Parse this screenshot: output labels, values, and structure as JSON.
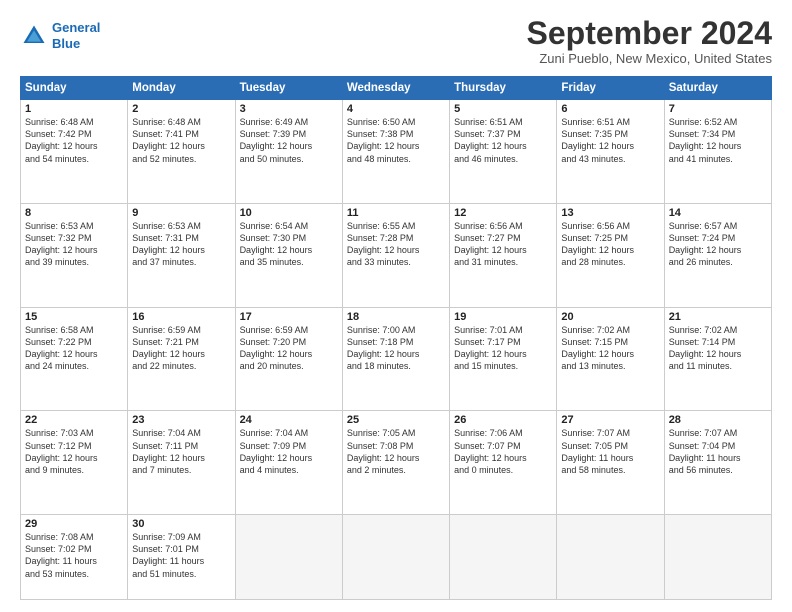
{
  "logo": {
    "line1": "General",
    "line2": "Blue"
  },
  "title": "September 2024",
  "subtitle": "Zuni Pueblo, New Mexico, United States",
  "header_days": [
    "Sunday",
    "Monday",
    "Tuesday",
    "Wednesday",
    "Thursday",
    "Friday",
    "Saturday"
  ],
  "weeks": [
    [
      {
        "num": "1",
        "info": "Sunrise: 6:48 AM\nSunset: 7:42 PM\nDaylight: 12 hours\nand 54 minutes."
      },
      {
        "num": "2",
        "info": "Sunrise: 6:48 AM\nSunset: 7:41 PM\nDaylight: 12 hours\nand 52 minutes."
      },
      {
        "num": "3",
        "info": "Sunrise: 6:49 AM\nSunset: 7:39 PM\nDaylight: 12 hours\nand 50 minutes."
      },
      {
        "num": "4",
        "info": "Sunrise: 6:50 AM\nSunset: 7:38 PM\nDaylight: 12 hours\nand 48 minutes."
      },
      {
        "num": "5",
        "info": "Sunrise: 6:51 AM\nSunset: 7:37 PM\nDaylight: 12 hours\nand 46 minutes."
      },
      {
        "num": "6",
        "info": "Sunrise: 6:51 AM\nSunset: 7:35 PM\nDaylight: 12 hours\nand 43 minutes."
      },
      {
        "num": "7",
        "info": "Sunrise: 6:52 AM\nSunset: 7:34 PM\nDaylight: 12 hours\nand 41 minutes."
      }
    ],
    [
      {
        "num": "8",
        "info": "Sunrise: 6:53 AM\nSunset: 7:32 PM\nDaylight: 12 hours\nand 39 minutes."
      },
      {
        "num": "9",
        "info": "Sunrise: 6:53 AM\nSunset: 7:31 PM\nDaylight: 12 hours\nand 37 minutes."
      },
      {
        "num": "10",
        "info": "Sunrise: 6:54 AM\nSunset: 7:30 PM\nDaylight: 12 hours\nand 35 minutes."
      },
      {
        "num": "11",
        "info": "Sunrise: 6:55 AM\nSunset: 7:28 PM\nDaylight: 12 hours\nand 33 minutes."
      },
      {
        "num": "12",
        "info": "Sunrise: 6:56 AM\nSunset: 7:27 PM\nDaylight: 12 hours\nand 31 minutes."
      },
      {
        "num": "13",
        "info": "Sunrise: 6:56 AM\nSunset: 7:25 PM\nDaylight: 12 hours\nand 28 minutes."
      },
      {
        "num": "14",
        "info": "Sunrise: 6:57 AM\nSunset: 7:24 PM\nDaylight: 12 hours\nand 26 minutes."
      }
    ],
    [
      {
        "num": "15",
        "info": "Sunrise: 6:58 AM\nSunset: 7:22 PM\nDaylight: 12 hours\nand 24 minutes."
      },
      {
        "num": "16",
        "info": "Sunrise: 6:59 AM\nSunset: 7:21 PM\nDaylight: 12 hours\nand 22 minutes."
      },
      {
        "num": "17",
        "info": "Sunrise: 6:59 AM\nSunset: 7:20 PM\nDaylight: 12 hours\nand 20 minutes."
      },
      {
        "num": "18",
        "info": "Sunrise: 7:00 AM\nSunset: 7:18 PM\nDaylight: 12 hours\nand 18 minutes."
      },
      {
        "num": "19",
        "info": "Sunrise: 7:01 AM\nSunset: 7:17 PM\nDaylight: 12 hours\nand 15 minutes."
      },
      {
        "num": "20",
        "info": "Sunrise: 7:02 AM\nSunset: 7:15 PM\nDaylight: 12 hours\nand 13 minutes."
      },
      {
        "num": "21",
        "info": "Sunrise: 7:02 AM\nSunset: 7:14 PM\nDaylight: 12 hours\nand 11 minutes."
      }
    ],
    [
      {
        "num": "22",
        "info": "Sunrise: 7:03 AM\nSunset: 7:12 PM\nDaylight: 12 hours\nand 9 minutes."
      },
      {
        "num": "23",
        "info": "Sunrise: 7:04 AM\nSunset: 7:11 PM\nDaylight: 12 hours\nand 7 minutes."
      },
      {
        "num": "24",
        "info": "Sunrise: 7:04 AM\nSunset: 7:09 PM\nDaylight: 12 hours\nand 4 minutes."
      },
      {
        "num": "25",
        "info": "Sunrise: 7:05 AM\nSunset: 7:08 PM\nDaylight: 12 hours\nand 2 minutes."
      },
      {
        "num": "26",
        "info": "Sunrise: 7:06 AM\nSunset: 7:07 PM\nDaylight: 12 hours\nand 0 minutes."
      },
      {
        "num": "27",
        "info": "Sunrise: 7:07 AM\nSunset: 7:05 PM\nDaylight: 11 hours\nand 58 minutes."
      },
      {
        "num": "28",
        "info": "Sunrise: 7:07 AM\nSunset: 7:04 PM\nDaylight: 11 hours\nand 56 minutes."
      }
    ],
    [
      {
        "num": "29",
        "info": "Sunrise: 7:08 AM\nSunset: 7:02 PM\nDaylight: 11 hours\nand 53 minutes."
      },
      {
        "num": "30",
        "info": "Sunrise: 7:09 AM\nSunset: 7:01 PM\nDaylight: 11 hours\nand 51 minutes."
      },
      {
        "num": "",
        "info": ""
      },
      {
        "num": "",
        "info": ""
      },
      {
        "num": "",
        "info": ""
      },
      {
        "num": "",
        "info": ""
      },
      {
        "num": "",
        "info": ""
      }
    ]
  ]
}
